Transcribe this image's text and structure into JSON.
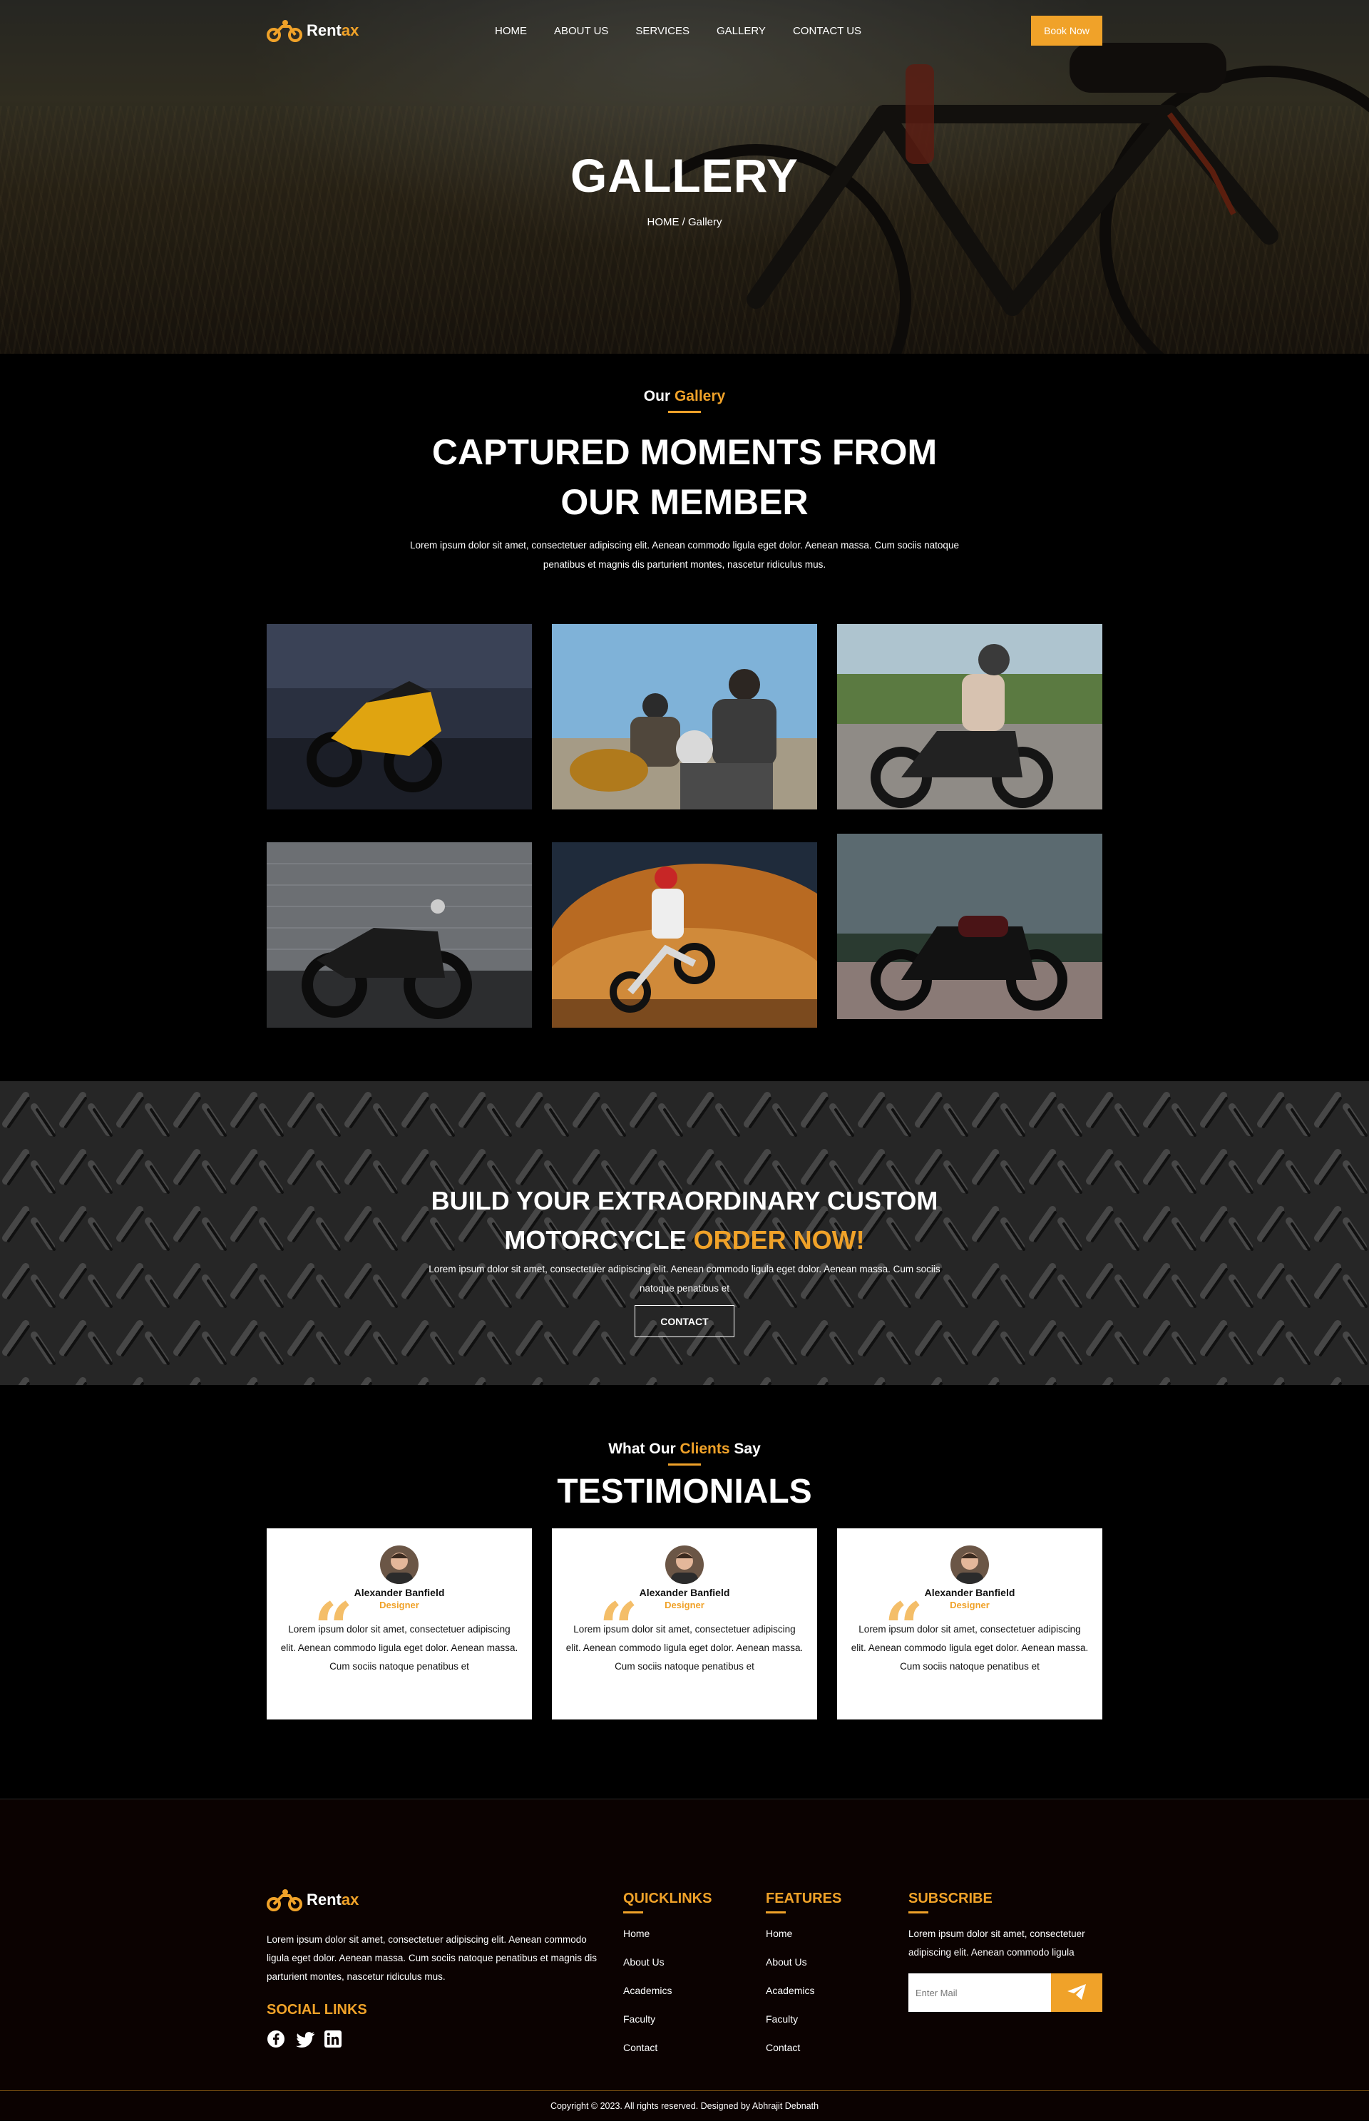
{
  "brand": {
    "name_main": "Rent",
    "name_accent": "ax"
  },
  "nav": {
    "items": [
      "HOME",
      "ABOUT US",
      "SERVICES",
      "GALLERY",
      "CONTACT US"
    ],
    "book_label": "Book Now"
  },
  "hero": {
    "title": "GALLERY",
    "breadcrumb": "HOME / Gallery"
  },
  "gallery": {
    "subtitle_plain": "Our ",
    "subtitle_accent": "Gallery",
    "title_line1": "CAPTURED MOMENTS FROM",
    "title_line2": "OUR MEMBER",
    "text": "Lorem ipsum dolor sit amet, consectetuer adipiscing elit. Aenean commodo ligula eget dolor. Aenean massa. Cum sociis natoque penatibus et magnis dis parturient montes, nascetur ridiculus mus."
  },
  "cta": {
    "title_line1": "BUILD YOUR EXTRAORDINARY CUSTOM",
    "title_line2_plain": "MOTORCYCLE ",
    "title_line2_accent": "ORDER NOW!",
    "text": "Lorem ipsum dolor sit amet, consectetuer adipiscing elit. Aenean commodo ligula eget dolor. Aenean massa. Cum sociis natoque penatibus et",
    "button_label": "CONTACT"
  },
  "testimonials": {
    "subtitle_a": "What Our ",
    "subtitle_accent": "Clients",
    "subtitle_b": " Say",
    "title": "TESTIMONIALS",
    "items": [
      {
        "name": "Alexander Banfield",
        "role": "Designer",
        "text": "Lorem ipsum dolor sit amet, consectetuer adipiscing elit. Aenean commodo ligula eget dolor. Aenean massa. Cum sociis natoque penatibus et"
      },
      {
        "name": "Alexander Banfield",
        "role": "Designer",
        "text": "Lorem ipsum dolor sit amet, consectetuer adipiscing elit. Aenean commodo ligula eget dolor. Aenean massa. Cum sociis natoque penatibus et"
      },
      {
        "name": "Alexander Banfield",
        "role": "Designer",
        "text": "Lorem ipsum dolor sit amet, consectetuer adipiscing elit. Aenean commodo ligula eget dolor. Aenean massa. Cum sociis natoque penatibus et"
      }
    ]
  },
  "footer": {
    "about": "Lorem ipsum dolor sit amet, consectetuer adipiscing elit. Aenean commodo ligula eget dolor. Aenean massa. Cum sociis natoque penatibus et magnis dis parturient montes, nascetur ridiculus mus.",
    "social_title": "SOCIAL LINKS",
    "social_icons": [
      "facebook-icon",
      "twitter-icon",
      "linkedin-icon"
    ],
    "quicklinks_title": "QUICKLINKS",
    "quicklinks": [
      "Home",
      "About Us",
      "Academics",
      "Faculty",
      "Contact"
    ],
    "features_title": "FEATURES",
    "features": [
      "Home",
      "About Us",
      "Academics",
      "Faculty",
      "Contact"
    ],
    "subscribe_title": "SUBSCRIBE",
    "subscribe_text": "Lorem ipsum dolor sit amet, consectetuer adipiscing elit. Aenean commodo ligula",
    "subscribe_placeholder": "Enter Mail",
    "copyright": "Copyright © 2023. All rights reserved. Designed by Abhrajit Debnath"
  },
  "colors": {
    "accent": "#f0a229",
    "background": "#000000",
    "footer_bg": "#0b0201"
  }
}
